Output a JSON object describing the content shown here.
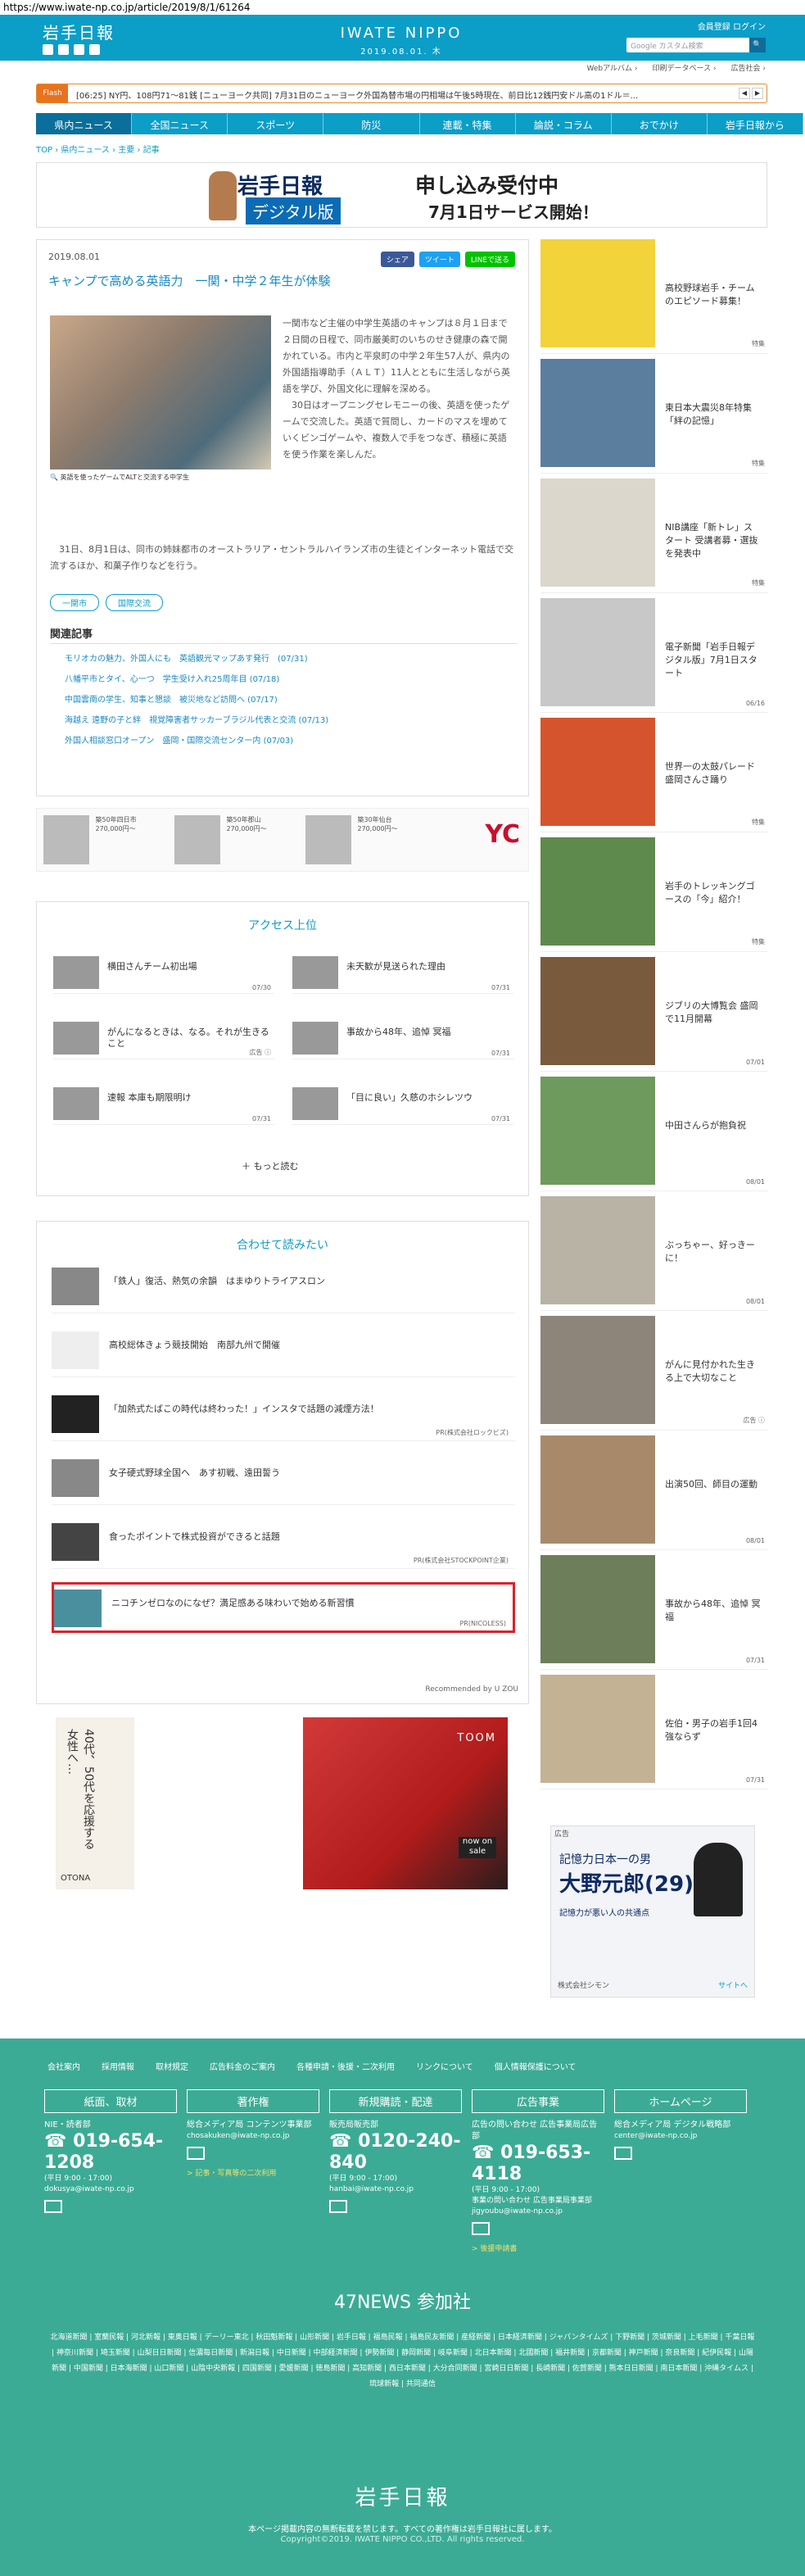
{
  "url": "https://www.iwate-np.co.jp/article/2019/8/1/61264",
  "header": {
    "logo": "岩手日報",
    "center_logo": "IWATE NIPPO",
    "date": "2019.08.01. 木",
    "member_links": "会員登録  ログイン",
    "search_placeholder": "Google カスタム検索",
    "search_button": "🔍"
  },
  "sub_links": [
    "Webアルバム ›",
    "印刷データベース ›",
    "広告社会 ›"
  ],
  "flash": {
    "label": "Flash",
    "text": "[06:25] NY円、108円71～81銭  [ニューヨーク共同] 7月31日のニューヨーク外国為替市場の円相場は午後5時現在、前日比12銭円安ドル高の1ドル＝..."
  },
  "nav": [
    "県内ニュース",
    "全国ニュース",
    "スポーツ",
    "防災",
    "連載・特集",
    "論説・コラム",
    "おでかけ",
    "岩手日報から"
  ],
  "breadcrumb": "TOP › 県内ニュース › 主要 › 記事",
  "banner": {
    "logo": "岩手日報",
    "tag": "デジタル版",
    "title": "申し込み受付中",
    "subtitle": "7月1日サービス開始！"
  },
  "article": {
    "date": "2019.08.01",
    "share": [
      "シェア",
      "ツイート",
      "LINEで送る"
    ],
    "title": "キャンプで高める英語力　一関・中学２年生が体験",
    "caption": "🔍 英語を使ったゲームでALTと交流する中学生",
    "body": "一関市など主催の中学生英語のキャンプは８月１日まで２日間の日程で、同市厳美町のいちのせき健康の森で開かれている。市内と平泉町の中学２年生57人が、県内の外国語指導助手（ＡＬＴ）11人とともに生活しながら英語を学び、外国文化に理解を深める。\n　30日はオープニングセレモニーの後、英語を使ったゲームで交流した。英語で質問し、カードのマスを埋めていくビンゴゲームや、複数人で手をつなぎ、積極に英語を使う作業を楽しんだ。",
    "body2": "　31日、8月1日は、同市の姉妹都市のオーストラリア・セントラルハイランズ市の生徒とインターネット電話で交流するほか、和菓子作りなどを行う。",
    "tags": [
      "一関市",
      "国際交流"
    ],
    "related_title": "関連記事",
    "related": [
      "モリオカの魅力、外国人にも　英語観光マップあす発行　(07/31)",
      "八幡平市とタイ、心一つ　学生受け入れ25周年目 (07/18)",
      "中国雲南の学生、知事と懇談　被災地など訪問へ (07/17)",
      "海越え 遠野の子と絆　視覚障害者サッカーブラジル代表と交流 (07/13)",
      "外国人相談窓口オープン　盛岡・国際交流センター内 (07/03)"
    ]
  },
  "ad_strip": {
    "cells": [
      {
        "title": "築50年四日市",
        "price": "270,000円～"
      },
      {
        "title": "築50年郡山",
        "price": "270,000円～"
      },
      {
        "title": "築30年仙台",
        "price": "270,000円～"
      }
    ],
    "logo": "YC"
  },
  "ranking": {
    "title": "アクセス上位",
    "items": [
      {
        "title": "横田さんチーム初出場",
        "date": "07/30"
      },
      {
        "title": "未天歓が見送られた理由",
        "date": "07/31"
      },
      {
        "title": "がんになるときは、なる。それが生きること",
        "date": "広告 ⓘ"
      },
      {
        "title": "事故から48年、追悼 冥福",
        "date": "07/31"
      },
      {
        "title": "速報 本庫も期限明け",
        "date": "07/31"
      },
      {
        "title": "「目に良い」久慈のホシレツウ",
        "date": "07/31"
      }
    ],
    "more": "もっと読む"
  },
  "recommend": {
    "title": "合わせて読みたい",
    "items": [
      {
        "title": "「鉄人」復活、熱気の余韻　はまゆりトライアスロン",
        "pr": ""
      },
      {
        "title": "高校総体きょう競技開始　南部九州で開催",
        "pr": ""
      },
      {
        "title": "「加熱式たばこの時代は終わった！」インスタで話題の減煙方法！",
        "pr": "PR(株式会社ロックビズ)"
      },
      {
        "title": "女子硬式野球全国へ　あす初戦、遠田誓う",
        "pr": ""
      },
      {
        "title": "食ったポイントで株式投資ができると話題",
        "pr": "PR(株式会社STOCKPOINT企業)"
      },
      {
        "title": "ニコチンゼロなのになぜ？満足感ある味わいで始める新習慣",
        "pr": "PR(NICOLESS)"
      }
    ],
    "powered": "Recommended by U ZOU"
  },
  "bottom_ads": {
    "a1_text": "40代、50代を応援する女性へ…",
    "a1_brand": "OTONA",
    "a2_brand": "TOOM",
    "a2_badge": "now on sale"
  },
  "sidebar": [
    {
      "title": "高校野球岩手・チームのエピソード募集！",
      "date": "特集"
    },
    {
      "title": "東日本大震災8年特集「絆の記憶」",
      "date": "特集"
    },
    {
      "title": "NIB講座「新トレ」スタート 受講者募・選抜を発表中",
      "date": "特集"
    },
    {
      "title": "電子新聞「岩手日報デジタル版」7月1日スタート",
      "date": "06/16"
    },
    {
      "title": "世界一の太鼓パレード 盛岡さんさ踊り",
      "date": "特集"
    },
    {
      "title": "岩手のトレッキングゴースの「今」紹介！",
      "date": "特集"
    },
    {
      "title": "ジブリの大博覧会 盛岡で11月開幕",
      "date": "07/01"
    },
    {
      "title": "中田さんらが抱負祝",
      "date": "08/01"
    },
    {
      "title": "ぶっちゃー、好っきーに！",
      "date": "08/01"
    },
    {
      "title": "がんに見付かれた生きる上で大切なこと",
      "date": "広告 ⓘ"
    },
    {
      "title": "出演50回、師目の運動",
      "date": "08/01"
    },
    {
      "title": "事故から48年、追悼 冥福",
      "date": "07/31"
    },
    {
      "title": "佐伯・男子の岩手1回4強ならず",
      "date": "07/31"
    }
  ],
  "side_ad": {
    "head": "広告",
    "line1": "記憶力日本一の男",
    "name": "大野元郎(29)",
    "line2": "記憶力が悪い人の共通点",
    "sponsor": "株式会社シモン",
    "link": "サイトへ"
  },
  "footer": {
    "links": [
      "会社案内",
      "採用情報",
      "取材規定",
      "広告料金のご案内",
      "各種申請・後援・二次利用",
      "リンクについて",
      "個人情報保護について"
    ],
    "columns": [
      {
        "head": "紙面、取材",
        "t1": "NIE・読者部",
        "tel": "019-654-1208",
        "sm": "(平日 9:00 - 17:00)",
        "mail_text": "dokusya@iwate-np.co.jp",
        "lnk": ""
      },
      {
        "head": "著作権",
        "t1": "総合メディア局 コンテンツ事業部",
        "tel": "",
        "sm": "",
        "mail_text": "chosakuken@iwate-np.co.jp",
        "lnk": "> 記事・写真等の二次利用"
      },
      {
        "head": "新規購読・配達",
        "t1": "販売局販売部",
        "tel": "0120-240-840",
        "sm": "(平日 9:00 - 17:00)",
        "mail_text": "hanbai@iwate-np.co.jp",
        "lnk": ""
      },
      {
        "head": "広告事業",
        "t1": "広告の問い合わせ 広告事業局広告部",
        "tel": "019-653-4118",
        "sm": "(平日 9:00 - 17:00)",
        "mail_text": "事業の問い合わせ 広告事業局事業部 jigyoubu@iwate-np.co.jp",
        "lnk": "> 後援申請書"
      },
      {
        "head": "ホームページ",
        "t1": "総合メディア局 デジタル戦略部",
        "tel": "",
        "sm": "",
        "mail_text": "center@iwate-np.co.jp",
        "lnk": ""
      }
    ],
    "n47": "47NEWS 参加社",
    "papers": "北海道新聞 | 室蘭民報 | 河北新報 | 東奥日報 | デーリー東北 | 秋田魁新報 | 山形新聞 | 岩手日報 | 福島民報 | 福島民友新聞 | 産経新聞 | 日本経済新聞 | ジャパンタイムズ | 下野新聞 | 茨城新聞 | 上毛新聞 | 千葉日報 | 神奈川新聞 | 埼玉新聞 | 山梨日日新聞 | 信濃毎日新聞 | 新潟日報 | 中日新聞 | 中部経済新聞 | 伊勢新聞 | 静岡新聞 | 岐阜新聞 | 北日本新聞 | 北國新聞 | 福井新聞 | 京都新聞 | 神戸新聞 | 奈良新聞 | 紀伊民報 | 山陽新聞 | 中国新聞 | 日本海新聞 | 山口新聞 | 山陰中央新報 | 四国新聞 | 愛媛新聞 | 徳島新聞 | 高知新聞 | 西日本新聞 | 大分合同新聞 | 宮崎日日新聞 | 長崎新聞 | 佐賀新聞 | 熊本日日新聞 | 南日本新聞 | 沖縄タイムス | 琉球新報 | 共同通信",
    "logo": "岩手日報",
    "note": "本ページ掲載内容の無断転載を禁じます。すべての著作権は岩手日報社に属します。",
    "copy": "Copyright©2019. IWATE NIPPO CO.,LTD. All rights reserved."
  }
}
